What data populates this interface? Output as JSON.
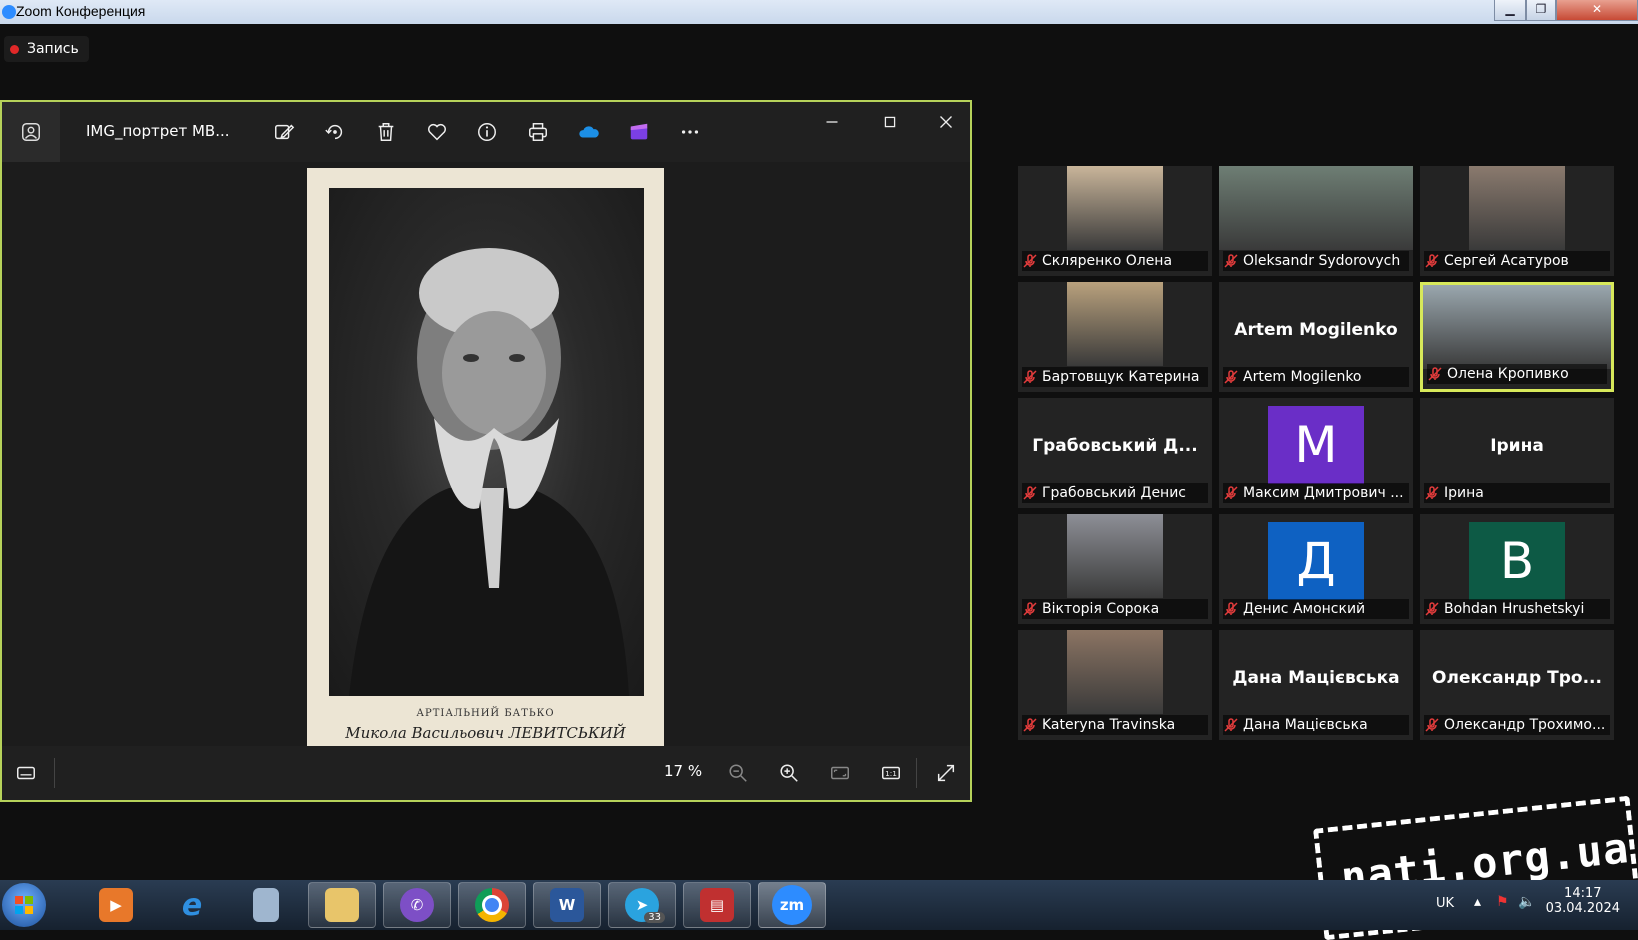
{
  "window": {
    "title": "Zoom Конференция",
    "buttons": [
      "minimize",
      "maximize",
      "close"
    ]
  },
  "recording": {
    "label": "Запись"
  },
  "viewer": {
    "filename": "IMG_портрет МВ...",
    "toolbar_icons": [
      "edit-icon",
      "rotate-icon",
      "delete-icon",
      "favorite-icon",
      "info-icon",
      "print-icon",
      "onedrive-icon",
      "clipchamp-icon",
      "more-icon"
    ],
    "photo_caption": {
      "line1": "АРТІАЛЬНИЙ БАТЬКО",
      "line2": "Микола Васильович ЛЕВИТСЬКИЙ"
    },
    "zoom_level": "17 %"
  },
  "participants": [
    {
      "name": "Скляренко Олена",
      "display": "video",
      "bg": "#c9b59a"
    },
    {
      "name": "Oleksandr Sydorovych",
      "display": "video",
      "bg": "#6e7e74"
    },
    {
      "name": "Сергей Асатуров",
      "display": "video",
      "bg": "#8a7a6e"
    },
    {
      "name": "Бартовщук Катерина",
      "display": "video",
      "bg": "#b9a17d"
    },
    {
      "name": "Artem Mogilenko",
      "display": "name",
      "big": "Artem Mogilenko"
    },
    {
      "name": "Олена Кропивко",
      "display": "video",
      "bg": "#9aa7ae",
      "active": true
    },
    {
      "name": "Грабовський Денис",
      "display": "name",
      "big": "Грабовський Д..."
    },
    {
      "name": "Максим Дмитрович ...",
      "display": "avatar",
      "letter": "M",
      "color": "#6a2ec7"
    },
    {
      "name": "Ірина",
      "display": "name",
      "big": "Ірина"
    },
    {
      "name": "Вікторія Сорока",
      "display": "video",
      "bg": "#8d8f96"
    },
    {
      "name": "Денис Амонский",
      "display": "avatar",
      "letter": "Д",
      "color": "#0e61c2"
    },
    {
      "name": "Bohdan Hrushetskyi",
      "display": "avatar",
      "letter": "B",
      "color": "#0d5a45"
    },
    {
      "name": "Katerynа Travinska",
      "display": "video",
      "bg": "#8b7463"
    },
    {
      "name": "Дана Мацієвська",
      "display": "name",
      "big": "Дана Мацієвська"
    },
    {
      "name": "Олександр Трохимо...",
      "display": "name",
      "big": "Олександр Тро..."
    }
  ],
  "taskbar": {
    "items": [
      "media-player",
      "internet-explorer",
      "calculator",
      "file-explorer",
      "viber",
      "chrome",
      "word",
      "telegram",
      "save-app",
      "zoom"
    ],
    "telegram_badge": "33",
    "zoom_label": "zm",
    "word_label": "W",
    "clock_time": "14:17",
    "clock_date": "03.04.2024",
    "lang": "UK"
  },
  "watermark": {
    "text": "nati.org.ua"
  }
}
